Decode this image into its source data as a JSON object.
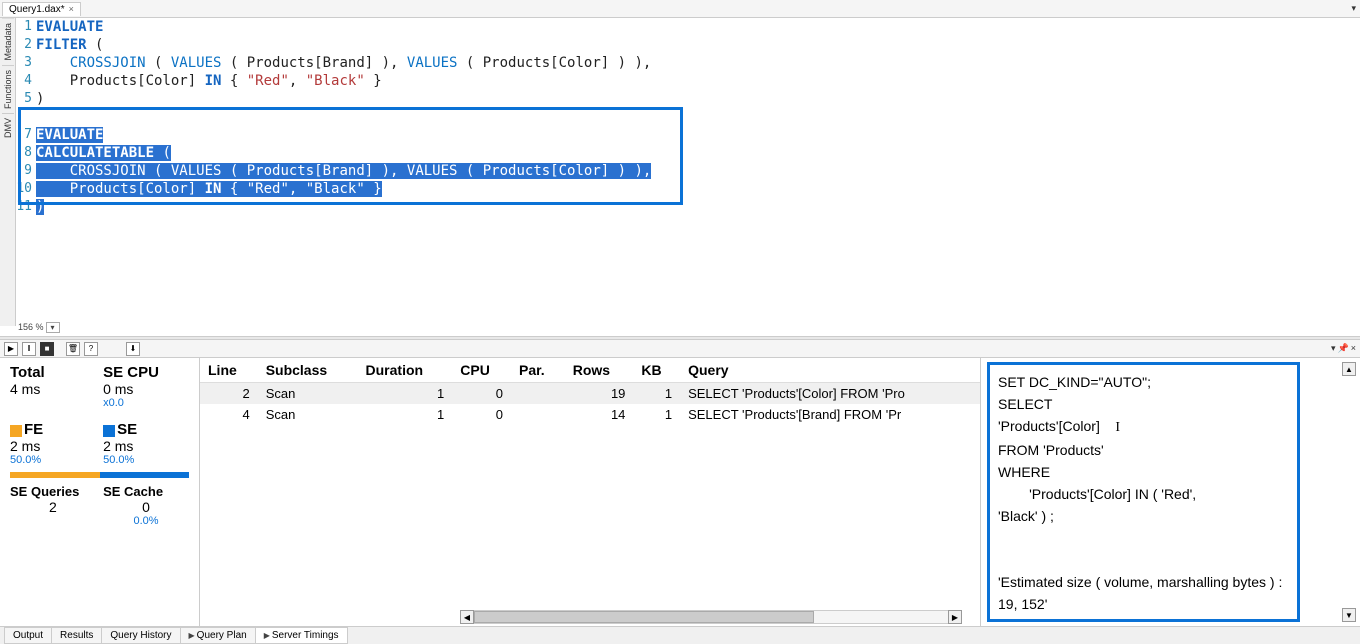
{
  "tab": {
    "title": "Query1.dax*",
    "close": "×",
    "rightIcon": "▾"
  },
  "leftTabs": [
    "Metadata",
    "Functions",
    "DMV"
  ],
  "code": {
    "lines": [
      {
        "n": "1",
        "tokens": [
          {
            "t": "EVALUATE",
            "c": "kw"
          }
        ]
      },
      {
        "n": "2",
        "tokens": [
          {
            "t": "FILTER",
            "c": "kw"
          },
          {
            "t": " (",
            "c": "op"
          }
        ]
      },
      {
        "n": "3",
        "tokens": [
          {
            "t": "    ",
            "c": "op"
          },
          {
            "t": "CROSSJOIN",
            "c": "func"
          },
          {
            "t": " ( ",
            "c": "op"
          },
          {
            "t": "VALUES",
            "c": "func"
          },
          {
            "t": " ( Products[Brand] ), ",
            "c": "ident"
          },
          {
            "t": "VALUES",
            "c": "func"
          },
          {
            "t": " ( Products[Color] ) ),",
            "c": "ident"
          }
        ]
      },
      {
        "n": "4",
        "tokens": [
          {
            "t": "    Products[Color] ",
            "c": "ident"
          },
          {
            "t": "IN",
            "c": "kw"
          },
          {
            "t": " { ",
            "c": "op"
          },
          {
            "t": "\"Red\"",
            "c": "str"
          },
          {
            "t": ", ",
            "c": "op"
          },
          {
            "t": "\"Black\"",
            "c": "str"
          },
          {
            "t": " }",
            "c": "op"
          }
        ]
      },
      {
        "n": "5",
        "tokens": [
          {
            "t": ")",
            "c": "op"
          }
        ]
      },
      {
        "n": "",
        "tokens": []
      },
      {
        "n": "7",
        "sel": true,
        "tokens": [
          {
            "t": "EVALUATE",
            "c": "kw"
          }
        ]
      },
      {
        "n": "8",
        "sel": true,
        "tokens": [
          {
            "t": "CALCULATETABLE",
            "c": "kw"
          },
          {
            "t": " (",
            "c": "op"
          }
        ]
      },
      {
        "n": "9",
        "sel": true,
        "tokens": [
          {
            "t": "    ",
            "c": "op"
          },
          {
            "t": "CROSSJOIN",
            "c": "func"
          },
          {
            "t": " ( ",
            "c": "op"
          },
          {
            "t": "VALUES",
            "c": "func"
          },
          {
            "t": " ( Products[Brand] ), ",
            "c": "ident"
          },
          {
            "t": "VALUES",
            "c": "func"
          },
          {
            "t": " ( Products[Color] ) ),",
            "c": "ident"
          }
        ]
      },
      {
        "n": "10",
        "sel": true,
        "tokens": [
          {
            "t": "    Products[Color] ",
            "c": "ident"
          },
          {
            "t": "IN",
            "c": "kw"
          },
          {
            "t": " { ",
            "c": "op"
          },
          {
            "t": "\"Red\"",
            "c": "str"
          },
          {
            "t": ", ",
            "c": "op"
          },
          {
            "t": "\"Black\"",
            "c": "str"
          },
          {
            "t": " }",
            "c": "op"
          }
        ]
      },
      {
        "n": "11",
        "sel": true,
        "tokens": [
          {
            "t": ")",
            "c": "op"
          }
        ]
      }
    ]
  },
  "zoom": "156 %",
  "toolbarIcons": {
    "play": "▶",
    "pause": "‖",
    "stop": "■",
    "clear": "🗑",
    "help": "?",
    "download": "⬇"
  },
  "pinIcons": {
    "dropdown": "▾",
    "pin": "📌",
    "close": "×"
  },
  "stats": {
    "totalLabel": "Total",
    "totalVal": "4 ms",
    "secpuLabel": "SE CPU",
    "secpuVal": "0 ms",
    "secpuSub": "x0.0",
    "feLabel": "FE",
    "feVal": "2 ms",
    "fePct": "50.0%",
    "seLabel": "SE",
    "seVal": "2 ms",
    "sePct": "50.0%",
    "seqLabel": "SE Queries",
    "seqVal": "2",
    "secLabel": "SE Cache",
    "secVal": "0",
    "secPct": "0.0%"
  },
  "events": {
    "headers": [
      "Line",
      "Subclass",
      "Duration",
      "CPU",
      "Par.",
      "Rows",
      "KB",
      "Query"
    ],
    "rows": [
      {
        "line": "2",
        "subclass": "Scan",
        "duration": "1",
        "cpu": "0",
        "par": "",
        "rows": "19",
        "kb": "1",
        "query": "SELECT 'Products'[Color] FROM 'Pro",
        "sel": true
      },
      {
        "line": "4",
        "subclass": "Scan",
        "duration": "1",
        "cpu": "0",
        "par": "",
        "rows": "14",
        "kb": "1",
        "query": "SELECT 'Products'[Brand] FROM 'Pr"
      }
    ]
  },
  "queryText": {
    "l1": "SET DC_KIND=\"AUTO\";",
    "l2": "SELECT",
    "l3": "'Products'[Color]",
    "l4": "FROM 'Products'",
    "l5": "WHERE",
    "l6": "        'Products'[Color] IN ( 'Red',",
    "l7": "'Black' ) ;",
    "l8": "",
    "l9": "",
    "l10": "'Estimated size ( volume, marshalling bytes ) : 19, 152'"
  },
  "bottomTabs": [
    "Output",
    "Results",
    "Query History",
    "Query Plan",
    "Server Timings"
  ],
  "activeBottomTab": 4,
  "scrollGlyphs": {
    "left": "◀",
    "right": "▶",
    "up": "▲",
    "down": "▼"
  }
}
